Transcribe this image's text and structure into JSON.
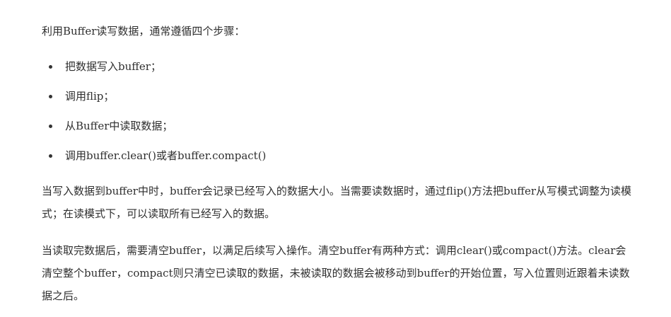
{
  "article": {
    "intro": "利用Buffer读写数据，通常遵循四个步骤：",
    "steps": [
      "把数据写入buffer；",
      "调用flip；",
      "从Buffer中读取数据；",
      "调用buffer.clear()或者buffer.compact()"
    ],
    "paragraphs": [
      "当写入数据到buffer中时，buffer会记录已经写入的数据大小。当需要读数据时，通过flip()方法把buffer从写模式调整为读模式；在读模式下，可以读取所有已经写入的数据。",
      "当读取完数据后，需要清空buffer，以满足后续写入操作。清空buffer有两种方式：调用clear()或compact()方法。clear会清空整个buffer，compact则只清空已读取的数据，未被读取的数据会被移动到buffer的开始位置，写入位置则近跟着未读数据之后。"
    ]
  }
}
